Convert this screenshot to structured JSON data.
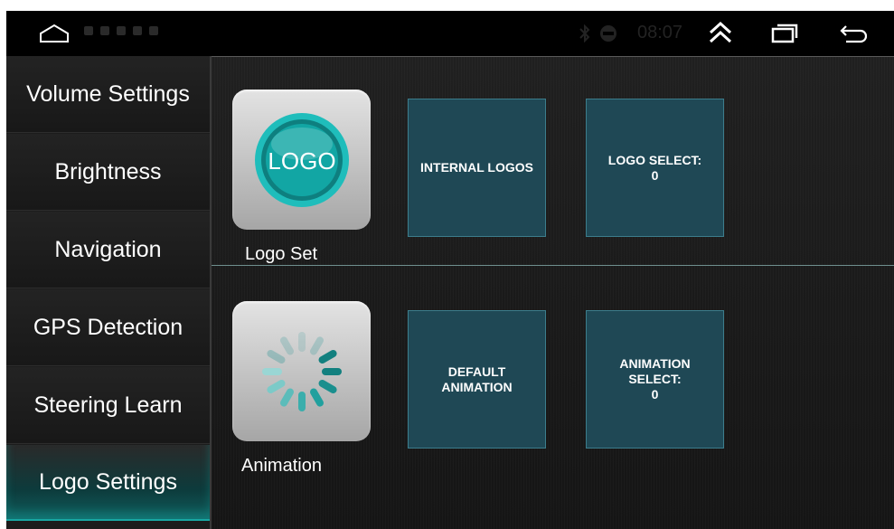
{
  "statusbar": {
    "time": "08:07",
    "icons": [
      "home-icon",
      "expand-up-icon",
      "recent-apps-icon",
      "back-icon",
      "bluetooth-icon",
      "signal-icon"
    ]
  },
  "sidebar": {
    "items": [
      {
        "label": "Volume Settings",
        "active": false
      },
      {
        "label": "Brightness",
        "active": false
      },
      {
        "label": "Navigation",
        "active": false
      },
      {
        "label": "GPS Detection",
        "active": false
      },
      {
        "label": "Steering Learn",
        "active": false
      },
      {
        "label": "Logo Settings",
        "active": true
      }
    ]
  },
  "logo_section": {
    "icon_text": "LOGO",
    "label": "Logo Set",
    "internal_logos": "INTERNAL LOGOS",
    "select_label": "LOGO SELECT:",
    "select_value": "0"
  },
  "animation_section": {
    "label": "Animation",
    "default_line1": "DEFAULT",
    "default_line2": "ANIMATION",
    "select_line1": "ANIMATION",
    "select_line2": "SELECT:",
    "select_value": "0"
  },
  "colors": {
    "accent": "#17a7a3",
    "tile_bg": "#1f4855",
    "tile_border": "#3c7d8c"
  }
}
